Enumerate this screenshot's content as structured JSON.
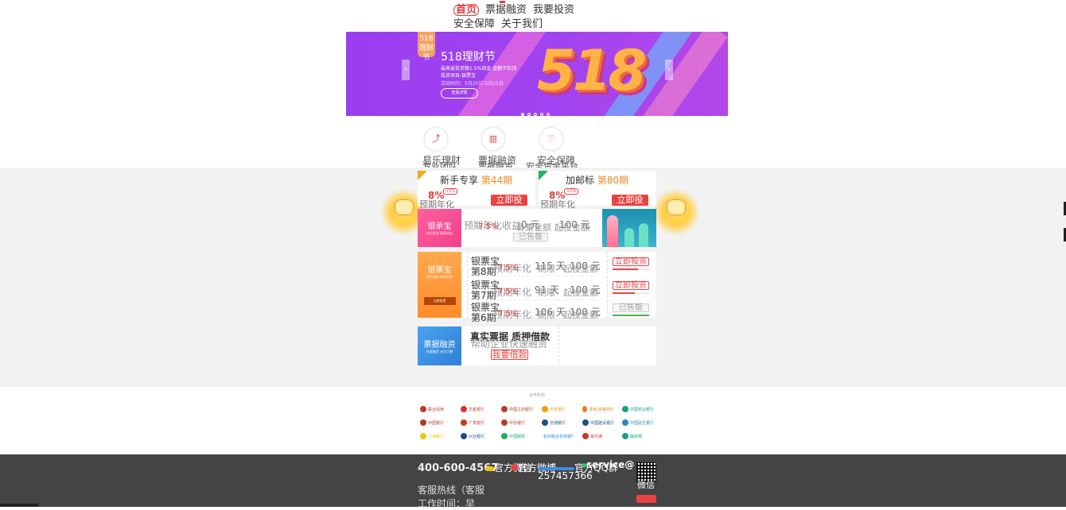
{
  "nav": {
    "items": [
      "首页",
      "票据融资",
      "我要投资",
      "安全保障",
      "关于我们"
    ],
    "active_index": 0
  },
  "banner": {
    "badge_top": "518",
    "badge_bottom": "理财节",
    "big_text": "518",
    "title": "518理财节",
    "line1": "最高返投资额1.5%现金 金额不封顶",
    "line2": "投资项目:银票宝",
    "line3": "活动时间：5月20日-5月25日",
    "button": "查看详情",
    "prev": "‹",
    "next": "›",
    "slide_count": 5,
    "active_slide": 0
  },
  "quick": [
    {
      "icon": "trend-icon",
      "label": "易乐理财",
      "sub": "专业团队"
    },
    {
      "icon": "book-icon",
      "label": "票据融资",
      "sub": "票据融资"
    },
    {
      "icon": "heart-icon",
      "label": "安全保障",
      "sub": "安全资金平台"
    }
  ],
  "cards": {
    "newbie": {
      "title": "新手专享",
      "period": "第44期",
      "rate": "8%",
      "tag": "+1%",
      "rate_label": "预期年化",
      "button": "立即投"
    },
    "bonus": {
      "title": "加邮标",
      "period": "第80期",
      "rate": "8%",
      "tag": "+1%",
      "rate_label": "预期年化",
      "button": "立即投"
    }
  },
  "yinchengbao": {
    "tile_title": "银承宝",
    "tile_sub": "快乐投资 稳享收益",
    "rate_label": "预期年化收益",
    "rate_value": "7.5%",
    "amount": "0 元",
    "amount_label": "募集金额",
    "min": "100 元",
    "min_label": "起投金额",
    "status": "已售罄"
  },
  "yinpiaobao": {
    "tile_title": "银票宝",
    "tile_sub": "稳定收益 保本保息",
    "tile_btn": "立即投资",
    "rows": [
      {
        "name": "银票宝",
        "issue": "第8期",
        "rate_label": "预期年化",
        "rate": "7.5%",
        "days": "115 天",
        "days_label": "期限",
        "min": "100 元",
        "min_label": "起投金额",
        "button": "立即投资",
        "progress": 0.7
      },
      {
        "name": "银票宝",
        "issue": "第7期",
        "rate_label": "预期年化",
        "rate": "7.5%",
        "days": "91 天",
        "days_label": "期限",
        "min": "100 元",
        "min_label": "起投金额",
        "button": "立即投资",
        "progress": 0.6
      },
      {
        "name": "银票宝",
        "issue": "第6期",
        "rate_label": "预期年化",
        "rate": "7.5%",
        "days": "106 天",
        "days_label": "期限",
        "min": "100 元",
        "min_label": "起投金额",
        "button": "已售罄",
        "progress": 1.0
      }
    ]
  },
  "financing": {
    "tile_title": "票据融资",
    "tile_sub": "快速融资 安全可靠",
    "headline": "真实票据 质押借款",
    "subline": "帮助企业快速融资",
    "button": "我要借款"
  },
  "partners": {
    "title": "合作机构",
    "logos": [
      {
        "name": "联合信用",
        "color": "#c0392b"
      },
      {
        "name": "华夏银行",
        "color": "#d63031"
      },
      {
        "name": "中国工商银行",
        "color": "#c0392b"
      },
      {
        "name": "平安银行",
        "color": "#f39c12"
      },
      {
        "name": "浙商·民泰商行",
        "color": "#e67e22"
      },
      {
        "name": "中国农业银行",
        "color": "#16a085"
      },
      {
        "name": "中国银行",
        "color": "#b03a2e"
      },
      {
        "name": "广发银行",
        "color": "#c0392b"
      },
      {
        "name": "中信银行",
        "color": "#c0392b"
      },
      {
        "name": "交通银行",
        "color": "#1f4e8c"
      },
      {
        "name": "中国建设银行",
        "color": "#1f4e8c"
      },
      {
        "name": "中国民生银行",
        "color": "#2e86c1"
      },
      {
        "name": "上海银行",
        "color": "#f1c40f"
      },
      {
        "name": "兴业银行",
        "color": "#1f4e8c"
      },
      {
        "name": "中国邮政",
        "color": "#27ae60"
      },
      {
        "name": "杭州联合农商银行",
        "color": "#2e86c1"
      },
      {
        "name": "易付通",
        "color": "#c0392b"
      },
      {
        "name": "融资网",
        "color": "#16a085"
      }
    ]
  },
  "footer": {
    "hotline": "400-600-4567",
    "line1": "客服热线（客服",
    "line2": "工作时间：早",
    "wechat": "官方微信",
    "weibo": "官方微博",
    "qq_label": "官方QQ群",
    "qq": "257457366",
    "service": "service@",
    "qr_label": "微信"
  }
}
